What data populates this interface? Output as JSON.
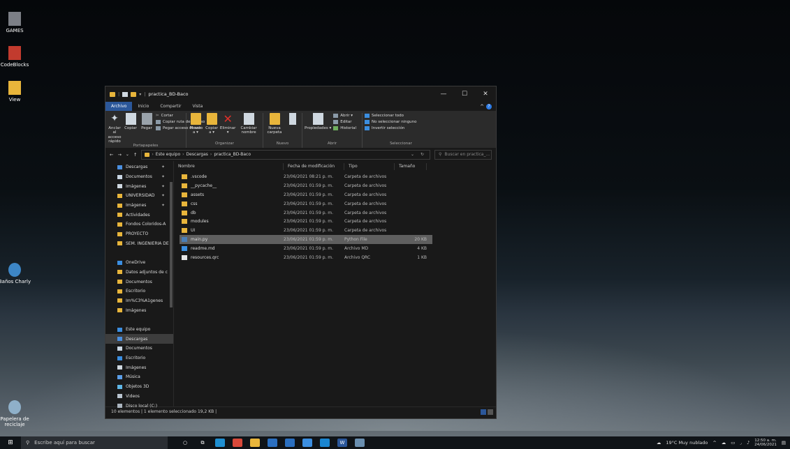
{
  "desktop": {
    "icons": [
      {
        "label": "GAMES",
        "icon": "games-folder-icon",
        "color": "#7c7f86"
      },
      {
        "label": "CodeBlocks",
        "icon": "codeblocks-icon",
        "color": "#c23b2e"
      },
      {
        "label": "View",
        "icon": "folder-icon",
        "color": "#e8b53b"
      },
      {
        "label": "Baños Charly",
        "icon": "user-icon",
        "color": "#3d86c6"
      },
      {
        "label": "Papelera de reciclaje",
        "icon": "recycle-bin-icon",
        "color": "#8fb0c9"
      }
    ]
  },
  "window": {
    "title": "practica_BD-Baco",
    "tabs": [
      "Archivo",
      "Inicio",
      "Compartir",
      "Vista"
    ],
    "ribbon": {
      "portapapeles": {
        "label": "Portapapeles",
        "anclar": "Anclar al acceso rápido",
        "copiar": "Copiar",
        "pegar": "Pegar",
        "cortar": "Cortar",
        "copiar_ruta": "Copiar ruta de acceso",
        "pegar_acceso": "Pegar acceso directo"
      },
      "organizar": {
        "label": "Organizar",
        "mover": "Mover a ▾",
        "copiar": "Copiar a ▾",
        "eliminar": "Eliminar ▾",
        "cambiar": "Cambiar nombre"
      },
      "nuevo": {
        "label": "Nuevo",
        "nueva_carpeta": "Nueva carpeta"
      },
      "abrir": {
        "label": "Abrir",
        "propiedades": "Propiedades ▾",
        "abrir": "Abrir ▾",
        "editar": "Editar",
        "historial": "Historial"
      },
      "seleccionar": {
        "label": "Seleccionar",
        "todo": "Seleccionar todo",
        "ninguno": "No seleccionar ninguno",
        "invertir": "Invertir selección"
      }
    },
    "address": {
      "path": [
        "Este equipo",
        "Descargas",
        "practica_BD-Baco"
      ],
      "search_placeholder": "Buscar en practica_..."
    },
    "nav": [
      {
        "label": "Descargas",
        "pin": true,
        "icon": "download-icon",
        "color": "#4a8fe0"
      },
      {
        "label": "Documentos",
        "pin": true,
        "icon": "documents-icon",
        "color": "#c9d6e3"
      },
      {
        "label": "Imágenes",
        "pin": true,
        "icon": "pictures-icon",
        "color": "#cfd8e0"
      },
      {
        "label": "UNIVERSIDAD",
        "pin": true,
        "icon": "folder-icon",
        "color": "#e8b53b"
      },
      {
        "label": "Imágenes",
        "pin": true,
        "icon": "folder-icon",
        "color": "#e8b53b"
      },
      {
        "label": "Actividades",
        "pin": false,
        "icon": "folder-icon",
        "color": "#e8b53b"
      },
      {
        "label": "Fondos Coloridos-A",
        "pin": false,
        "icon": "folder-icon",
        "color": "#e8b53b"
      },
      {
        "label": "PROYECTO",
        "pin": false,
        "icon": "folder-icon",
        "color": "#e8b53b"
      },
      {
        "label": "SEM. INGENIERIA DE",
        "pin": false,
        "icon": "folder-icon",
        "color": "#e8b53b"
      },
      {
        "label": "",
        "pin": false,
        "icon": "",
        "color": ""
      },
      {
        "label": "OneDrive",
        "pin": false,
        "icon": "onedrive-icon",
        "color": "#3b8ee0"
      },
      {
        "label": "Datos adjuntos de c",
        "pin": false,
        "icon": "folder-icon",
        "color": "#e8b53b"
      },
      {
        "label": "Documentos",
        "pin": false,
        "icon": "folder-icon",
        "color": "#e8b53b"
      },
      {
        "label": "Escritorio",
        "pin": false,
        "icon": "folder-icon",
        "color": "#e8b53b"
      },
      {
        "label": "Im%C3%A1genes",
        "pin": false,
        "icon": "folder-icon",
        "color": "#e8b53b"
      },
      {
        "label": "Imágenes",
        "pin": false,
        "icon": "folder-icon",
        "color": "#e8b53b"
      },
      {
        "label": "",
        "pin": false,
        "icon": "",
        "color": ""
      },
      {
        "label": "Este equipo",
        "pin": false,
        "icon": "pc-icon",
        "color": "#3b8ee0"
      },
      {
        "label": "Descargas",
        "pin": false,
        "icon": "download-icon",
        "color": "#4a8fe0",
        "selected": true
      },
      {
        "label": "Documentos",
        "pin": false,
        "icon": "documents-icon",
        "color": "#c9d6e3"
      },
      {
        "label": "Escritorio",
        "pin": false,
        "icon": "desktop-icon",
        "color": "#3b8ee0"
      },
      {
        "label": "Imágenes",
        "pin": false,
        "icon": "pictures-icon",
        "color": "#cfd8e0"
      },
      {
        "label": "Música",
        "pin": false,
        "icon": "music-icon",
        "color": "#5b9ee8"
      },
      {
        "label": "Objetos 3D",
        "pin": false,
        "icon": "3d-objects-icon",
        "color": "#5fb6e6"
      },
      {
        "label": "Videos",
        "pin": false,
        "icon": "videos-icon",
        "color": "#b9c4cf"
      },
      {
        "label": "Disco local (C:)",
        "pin": false,
        "icon": "drive-icon",
        "color": "#aab4be"
      }
    ],
    "columns": [
      "Nombre",
      "Fecha de modificación",
      "Tipo",
      "Tamaño"
    ],
    "files": [
      {
        "name": ".vscode",
        "date": "23/06/2021 08:21 p. m.",
        "type": "Carpeta de archivos",
        "size": "",
        "icon": "folder-icon",
        "color": "#e8b53b"
      },
      {
        "name": "__pycache__",
        "date": "23/06/2021 01:59 p. m.",
        "type": "Carpeta de archivos",
        "size": "",
        "icon": "folder-icon",
        "color": "#e8b53b"
      },
      {
        "name": "assets",
        "date": "23/06/2021 01:59 p. m.",
        "type": "Carpeta de archivos",
        "size": "",
        "icon": "folder-icon",
        "color": "#e8b53b"
      },
      {
        "name": "css",
        "date": "23/06/2021 01:59 p. m.",
        "type": "Carpeta de archivos",
        "size": "",
        "icon": "folder-icon",
        "color": "#e8b53b"
      },
      {
        "name": "db",
        "date": "23/06/2021 01:59 p. m.",
        "type": "Carpeta de archivos",
        "size": "",
        "icon": "folder-icon",
        "color": "#e8b53b"
      },
      {
        "name": "modules",
        "date": "23/06/2021 01:59 p. m.",
        "type": "Carpeta de archivos",
        "size": "",
        "icon": "folder-icon",
        "color": "#e8b53b"
      },
      {
        "name": "UI",
        "date": "23/06/2021 01:59 p. m.",
        "type": "Carpeta de archivos",
        "size": "",
        "icon": "folder-icon",
        "color": "#e8b53b"
      },
      {
        "name": "main.py",
        "date": "23/06/2021 01:59 p. m.",
        "type": "Python File",
        "size": "20 KB",
        "icon": "python-file-icon",
        "color": "#4a7fb8",
        "selected": true
      },
      {
        "name": "readme.md",
        "date": "23/06/2021 01:59 p. m.",
        "type": "Archivo MD",
        "size": "4 KB",
        "icon": "vscode-file-icon",
        "color": "#3b8ee0"
      },
      {
        "name": "resources.qrc",
        "date": "23/06/2021 01:59 p. m.",
        "type": "Archivo QRC",
        "size": "1 KB",
        "icon": "file-icon",
        "color": "#e6e6e6"
      }
    ],
    "status": "10 elementos  |  1 elemento seleccionado  19,2 KB  |"
  },
  "taskbar": {
    "search_placeholder": "Escribe aquí para buscar",
    "apps": [
      {
        "icon": "cortana-icon",
        "color": "#101418",
        "glyph": "○"
      },
      {
        "icon": "task-view-icon",
        "color": "#101418",
        "glyph": "⧉"
      },
      {
        "icon": "edge-icon",
        "color": "#1f8fd1",
        "glyph": ""
      },
      {
        "icon": "chrome-icon",
        "color": "#d8493a",
        "glyph": ""
      },
      {
        "icon": "file-explorer-icon",
        "color": "#e8b53b",
        "glyph": ""
      },
      {
        "icon": "mail-icon",
        "color": "#2b6fc0",
        "glyph": ""
      },
      {
        "icon": "store-icon",
        "color": "#2b6fc0",
        "glyph": ""
      },
      {
        "icon": "app-icon",
        "color": "#3b8ee0",
        "glyph": ""
      },
      {
        "icon": "vscode-icon",
        "color": "#1a86d1",
        "glyph": ""
      },
      {
        "icon": "word-icon",
        "color": "#2b579a",
        "glyph": "W"
      },
      {
        "icon": "photos-icon",
        "color": "#6a8fb0",
        "glyph": ""
      }
    ],
    "weather": "19°C  Muy nublado",
    "time": "12:50 a. m.",
    "date": "24/06/2021"
  }
}
